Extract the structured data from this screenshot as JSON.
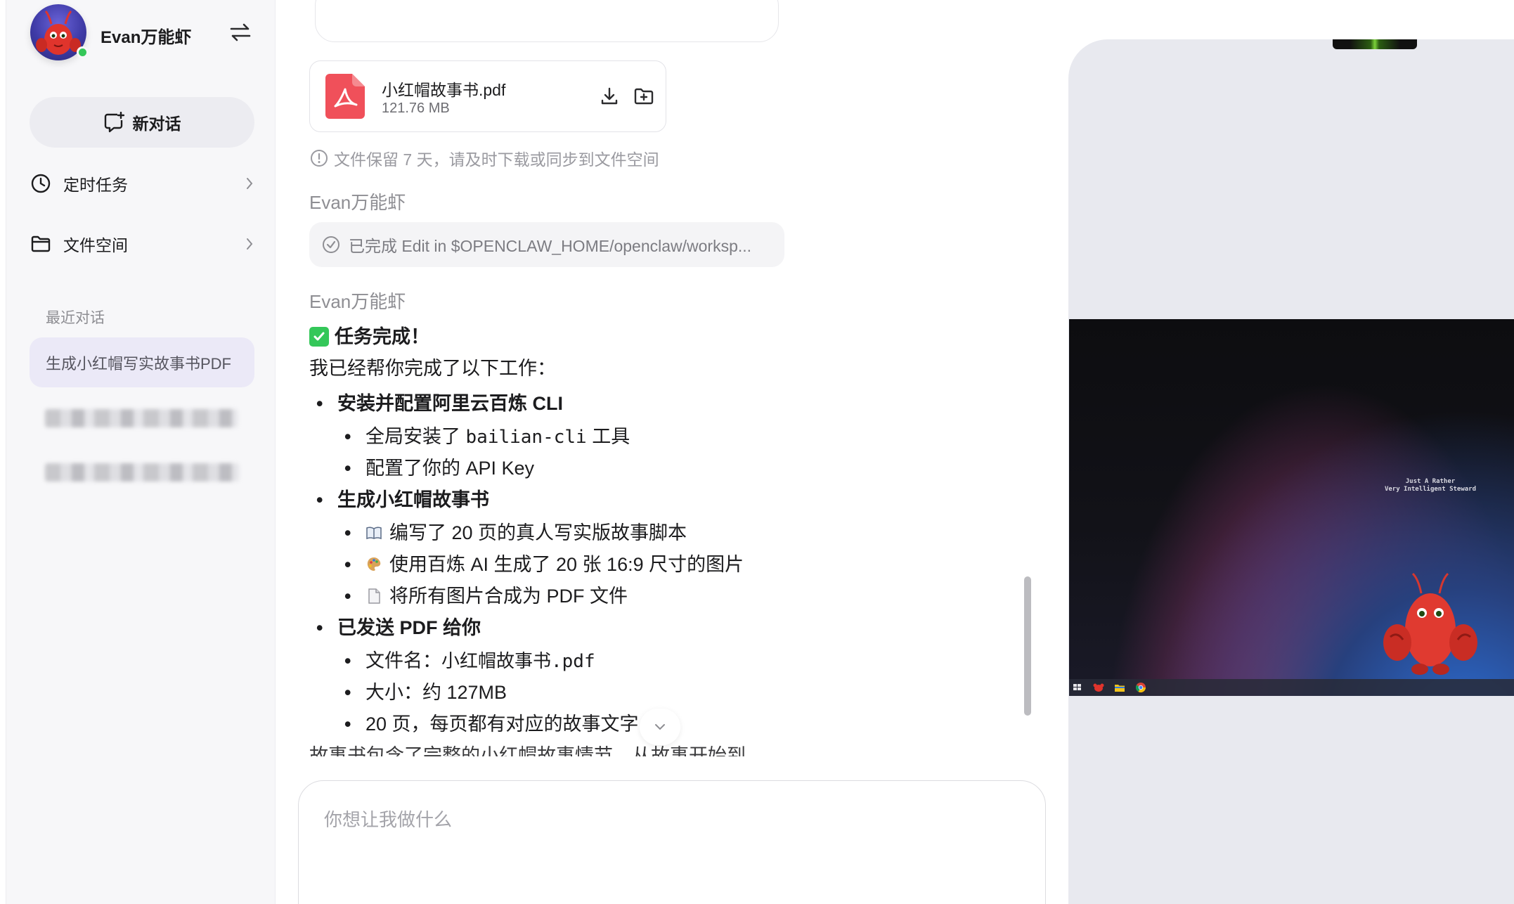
{
  "user": {
    "name": "Evan万能虾",
    "status": "online"
  },
  "sidebar": {
    "new_chat_label": "新对话",
    "nav": [
      {
        "label": "定时任务",
        "icon": "clock-icon"
      },
      {
        "label": "文件空间",
        "icon": "folder-icon"
      }
    ],
    "recent_label": "最近对话",
    "recent": [
      {
        "title": "生成小红帽写实故事书PDF",
        "active": true
      },
      {
        "title": "",
        "blurred": true
      },
      {
        "title": "",
        "blurred": true
      }
    ]
  },
  "chat": {
    "file": {
      "name": "小红帽故事书.pdf",
      "size": "121.76 MB"
    },
    "file_notice": "文件保留 7 天，请及时下载或同步到文件空间",
    "sender_1": "Evan万能虾",
    "tool_status": "已完成 Edit in $OPENCLAW_HOME/openclaw/worksp...",
    "sender_2": "Evan万能虾",
    "message": {
      "title": "任务完成！",
      "intro": "我已经帮你完成了以下工作：",
      "sections": [
        {
          "heading": "安装并配置阿里云百炼 CLI",
          "items": [
            {
              "pre": "全局安装了 ",
              "code": "bailian-cli",
              "post": " 工具"
            },
            {
              "text": "配置了你的 API Key"
            }
          ]
        },
        {
          "heading": "生成小红帽故事书",
          "items": [
            {
              "emoji": "book-icon",
              "text": "编写了 20 页的真人写实版故事脚本"
            },
            {
              "emoji": "palette-icon",
              "text": "使用百炼 AI 生成了 20 张 16:9 尺寸的图片"
            },
            {
              "emoji": "document-icon",
              "text": "将所有图片合成为 PDF 文件"
            }
          ]
        },
        {
          "heading": "已发送 PDF 给你",
          "items": [
            {
              "pre": "文件名：",
              "code": "小红帽故事书.pdf",
              "post": ""
            },
            {
              "text": "大小：约 127MB"
            },
            {
              "text": "20 页，每页都有对应的故事文字"
            }
          ]
        }
      ],
      "trailing_cut": "故事书包含了完整的小红帽故事情节，从故事开始到"
    }
  },
  "composer": {
    "placeholder": "你想让我做什么",
    "value": ""
  },
  "preview": {
    "wallpaper_caption_line1": "Just A Rather",
    "wallpaper_caption_line2": "Very Intelligent Steward",
    "taskbar_icons": [
      "windows-start-icon",
      "lobster-app-icon",
      "file-explorer-icon",
      "chrome-icon"
    ]
  },
  "colors": {
    "accent_active_bg": "#ebe9f7",
    "online": "#35c759",
    "pdf_red": "#f0505a",
    "check_green": "#34c759"
  }
}
